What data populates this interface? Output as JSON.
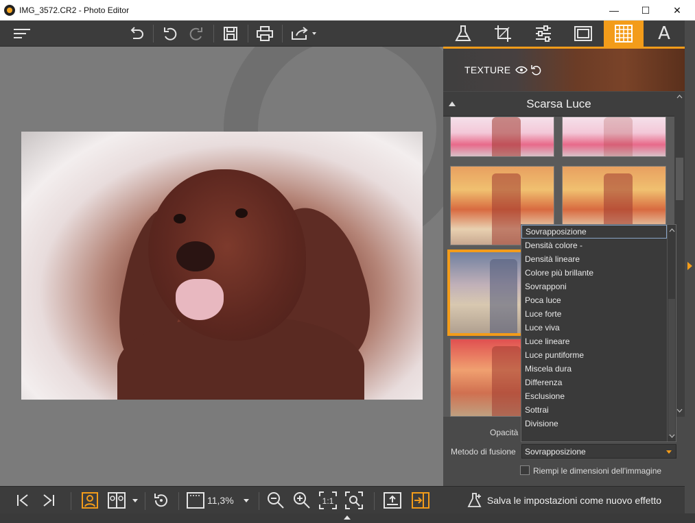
{
  "window": {
    "title": "IMG_3572.CR2 - Photo Editor",
    "controls": {
      "minimize": "—",
      "maximize": "☐",
      "close": "✕"
    }
  },
  "toolbar": {
    "icons": [
      "menu-icon",
      "undo-all-icon",
      "undo-icon",
      "redo-icon",
      "save-icon",
      "print-icon",
      "share-icon"
    ]
  },
  "bottom_toolbar": {
    "zoom": "11,3%",
    "fit_label": "1:1"
  },
  "panel": {
    "tabs": [
      "flask-icon",
      "crop-icon",
      "adjust-icon",
      "frame-icon",
      "texture-icon",
      "text-icon"
    ],
    "active_tab": "texture-icon",
    "text_tab_label": "A",
    "texture_header": "TEXTURE",
    "section_title": "Scarsa Luce",
    "opacity_label": "Opacità",
    "blend_label": "Metodo di fusione",
    "blend_value": "Sovrapposizione",
    "fill_checkbox_label": "Riempi le dimensioni dell'immagine",
    "save_button": "Salva le impostazioni come nuovo effetto"
  },
  "dropdown": {
    "options": [
      "Sovrapposizione",
      "Densità colore -",
      "Densità lineare",
      "Colore più brillante",
      "Sovrapponi",
      "Poca luce",
      "Luce forte",
      "Luce viva",
      "Luce lineare",
      "Luce puntiforme",
      "Miscela dura",
      "Differenza",
      "Esclusione",
      "Sottrai",
      "Divisione"
    ],
    "selected": "Sovrapposizione"
  },
  "colors": {
    "accent": "#f39c1a",
    "toolbar_bg": "#3c3c3c",
    "canvas_bg": "#7b7b7b"
  }
}
